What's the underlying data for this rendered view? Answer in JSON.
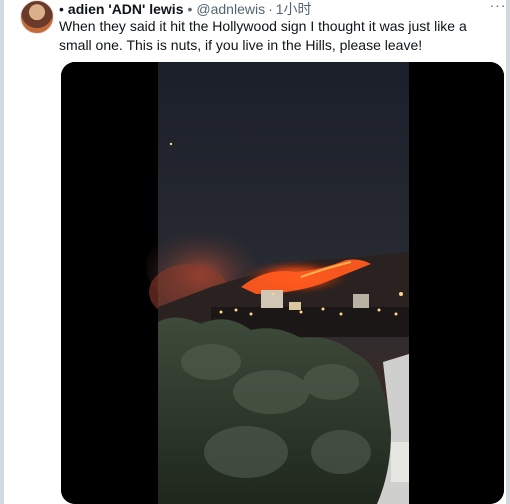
{
  "tweet": {
    "bullet": "•",
    "display_name": "adien 'ADN' lewis",
    "separator": "•",
    "handle": "@adnlewis",
    "dot": "·",
    "time": "1小时",
    "more_label": "···",
    "text": "When they said it hit the Hollywood sign I thought it was just like a small one. This is nuts, if you live in the Hills, please leave!",
    "media": {
      "type": "video",
      "description_icon": "video-frame"
    }
  },
  "colors": {
    "text_primary": "#0f1419",
    "text_secondary": "#536471",
    "media_bg": "#000000",
    "fire": "#ff5a1f"
  }
}
